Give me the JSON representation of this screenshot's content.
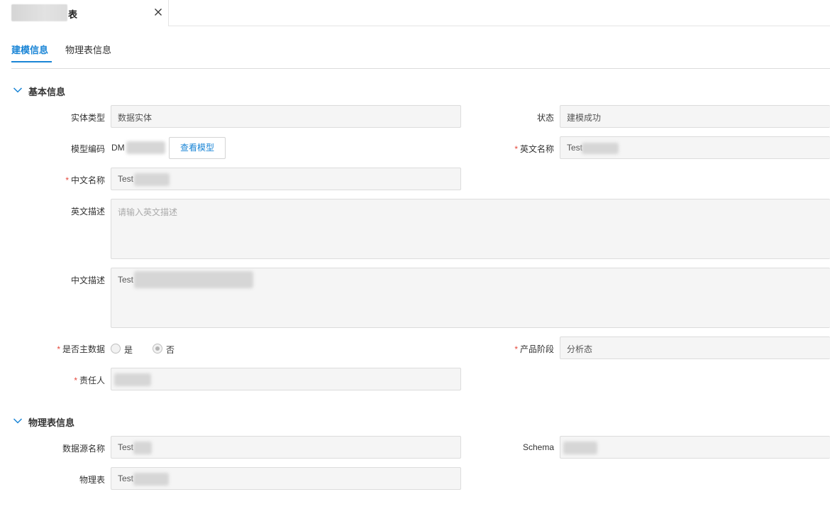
{
  "doc_tab": {
    "title": "表"
  },
  "subtabs": [
    {
      "label": "建模信息",
      "active": true
    },
    {
      "label": "物理表信息",
      "active": false
    }
  ],
  "accent_color": "#1a85d6",
  "required_color": "#e5483c",
  "basic_section": {
    "title": "基本信息",
    "entity_type": {
      "label": "实体类型",
      "value": "数据实体"
    },
    "status": {
      "label": "状态",
      "value": "建模成功"
    },
    "model_code": {
      "label": "模型编码",
      "value": "DM",
      "view_button": "查看模型"
    },
    "english_name": {
      "label": "英文名称",
      "required": "*",
      "value": "Test"
    },
    "chinese_name": {
      "label": "中文名称",
      "required": "*",
      "value": "Test"
    },
    "english_desc": {
      "label": "英文描述",
      "placeholder": "请输入英文描述"
    },
    "chinese_desc": {
      "label": "中文描述",
      "value": "Test"
    },
    "is_master_data": {
      "label": "是否主数据",
      "required": "*",
      "options": [
        "是",
        "否"
      ],
      "selected": "否"
    },
    "product_stage": {
      "label": "产品阶段",
      "required": "*",
      "value": "分析态"
    },
    "owner": {
      "label": "责任人",
      "required": "*"
    }
  },
  "physical_section": {
    "title": "物理表信息",
    "datasource_name": {
      "label": "数据源名称",
      "value": "Test"
    },
    "schema": {
      "label": "Schema"
    },
    "physical_table": {
      "label": "物理表",
      "value": "Test"
    }
  }
}
